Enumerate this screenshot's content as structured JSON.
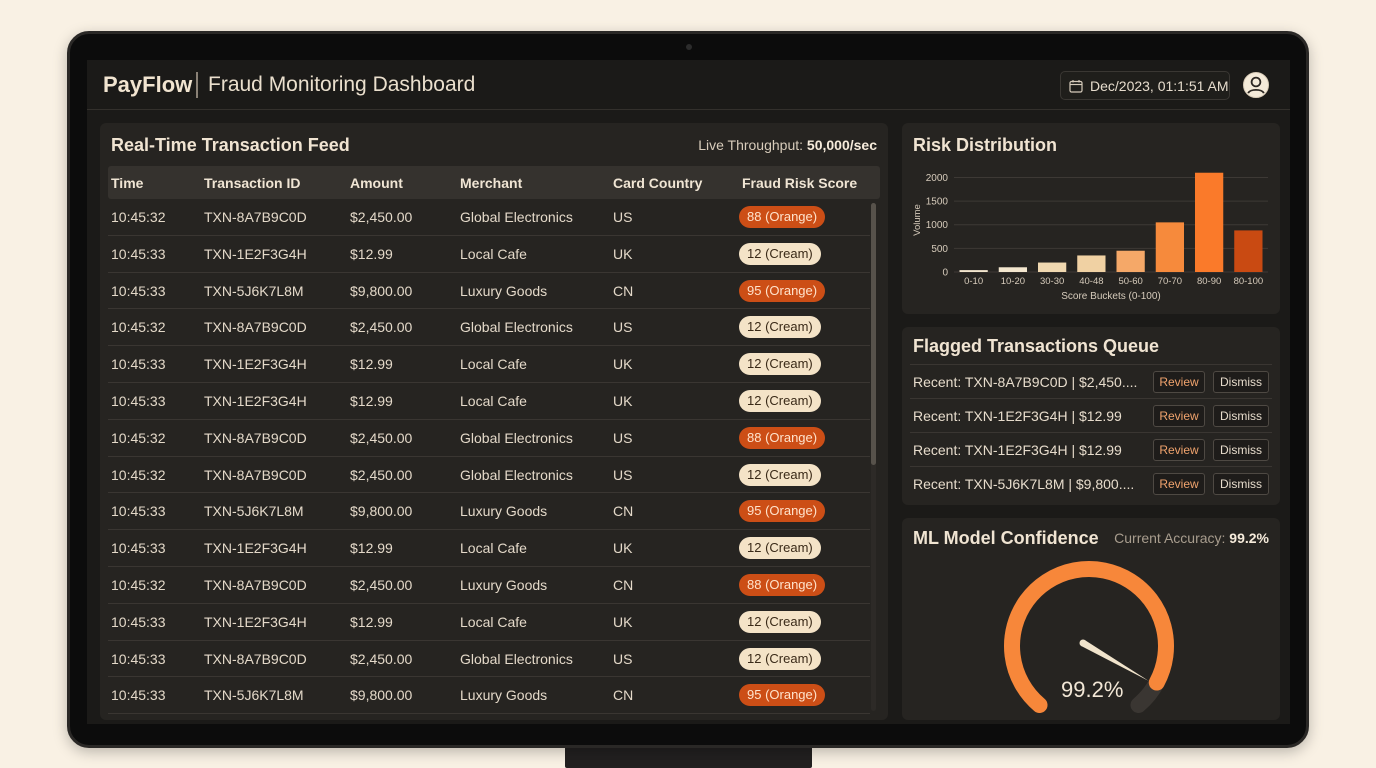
{
  "header": {
    "brand": "PayFlow",
    "title": "Fraud Monitoring Dashboard",
    "datetime": "Dec/2023, 01:1:51 AM"
  },
  "feed": {
    "title": "Real-Time Transaction Feed",
    "throughput_label": "Live Throughput:",
    "throughput_value": "50,000/sec",
    "columns": [
      "Time",
      "Transaction ID",
      "Amount",
      "Merchant",
      "Card Country",
      "Fraud Risk Score"
    ],
    "rows": [
      {
        "time": "10:45:32",
        "id": "TXN-8A7B9C0D",
        "amount": "$2,450.00",
        "merchant": "Global Electronics",
        "country": "US",
        "score": "88 (Orange)",
        "level": "orange"
      },
      {
        "time": "10:45:33",
        "id": "TXN-1E2F3G4H",
        "amount": "$12.99",
        "merchant": "Local Cafe",
        "country": "UK",
        "score": "12 (Cream)",
        "level": "cream"
      },
      {
        "time": "10:45:33",
        "id": "TXN-5J6K7L8M",
        "amount": "$9,800.00",
        "merchant": "Luxury Goods",
        "country": "CN",
        "score": "95 (Orange)",
        "level": "orange"
      },
      {
        "time": "10:45:32",
        "id": "TXN-8A7B9C0D",
        "amount": "$2,450.00",
        "merchant": "Global Electronics",
        "country": "US",
        "score": "12 (Cream)",
        "level": "cream"
      },
      {
        "time": "10:45:33",
        "id": "TXN-1E2F3G4H",
        "amount": "$12.99",
        "merchant": "Local Cafe",
        "country": "UK",
        "score": "12 (Cream)",
        "level": "cream"
      },
      {
        "time": "10:45:33",
        "id": "TXN-1E2F3G4H",
        "amount": "$12.99",
        "merchant": "Local Cafe",
        "country": "UK",
        "score": "12 (Cream)",
        "level": "cream"
      },
      {
        "time": "10:45:32",
        "id": "TXN-8A7B9C0D",
        "amount": "$2,450.00",
        "merchant": "Global Electronics",
        "country": "US",
        "score": "88 (Orange)",
        "level": "orange"
      },
      {
        "time": "10:45:32",
        "id": "TXN-8A7B9C0D",
        "amount": "$2,450.00",
        "merchant": "Global Electronics",
        "country": "US",
        "score": "12 (Cream)",
        "level": "cream"
      },
      {
        "time": "10:45:33",
        "id": "TXN-5J6K7L8M",
        "amount": "$9,800.00",
        "merchant": "Luxury Goods",
        "country": "CN",
        "score": "95 (Orange)",
        "level": "orange"
      },
      {
        "time": "10:45:33",
        "id": "TXN-1E2F3G4H",
        "amount": "$12.99",
        "merchant": "Local Cafe",
        "country": "UK",
        "score": "12 (Cream)",
        "level": "cream"
      },
      {
        "time": "10:45:32",
        "id": "TXN-8A7B9C0D",
        "amount": "$2,450.00",
        "merchant": "Luxury Goods",
        "country": "CN",
        "score": "88 (Orange)",
        "level": "orange"
      },
      {
        "time": "10:45:33",
        "id": "TXN-1E2F3G4H",
        "amount": "$12.99",
        "merchant": "Local Cafe",
        "country": "UK",
        "score": "12 (Cream)",
        "level": "cream"
      },
      {
        "time": "10:45:33",
        "id": "TXN-8A7B9C0D",
        "amount": "$2,450.00",
        "merchant": "Global Electronics",
        "country": "US",
        "score": "12 (Cream)",
        "level": "cream"
      },
      {
        "time": "10:45:33",
        "id": "TXN-5J6K7L8M",
        "amount": "$9,800.00",
        "merchant": "Luxury Goods",
        "country": "CN",
        "score": "95 (Orange)",
        "level": "orange"
      }
    ]
  },
  "risk": {
    "title": "Risk Distribution",
    "chart_data": {
      "type": "bar",
      "title": "Risk Distribution",
      "categories": [
        "0-10",
        "10-20",
        "30-30",
        "40-48",
        "50-60",
        "70-70",
        "80-90",
        "80-100"
      ],
      "values": [
        40,
        100,
        200,
        350,
        450,
        1050,
        2100,
        880
      ],
      "colors": [
        "#f3e6ce",
        "#f3e6ce",
        "#f0d8b0",
        "#f0d1a3",
        "#f5a868",
        "#f68a3c",
        "#fa7a2a",
        "#c94a12"
      ],
      "xlabel": "Score Buckets (0-100)",
      "ylabel": "Volume",
      "yticks": [
        0,
        500,
        1000,
        1500,
        2000
      ],
      "ylim": [
        0,
        2200
      ],
      "grid": true
    }
  },
  "queue": {
    "title": "Flagged Transactions Queue",
    "review_label": "Review",
    "dismiss_label": "Dismiss",
    "items": [
      "Recent: TXN-8A7B9C0D | $2,450....",
      "Recent: TXN-1E2F3G4H | $12.99",
      "Recent: TXN-1E2F3G4H | $12.99",
      "Recent: TXN-5J6K7L8M | $9,800...."
    ]
  },
  "model": {
    "title": "ML Model Confidence",
    "accuracy_label": "Current Accuracy:",
    "accuracy_value": "99.2%",
    "gauge_display": "99.2%",
    "gauge_fraction": 0.992,
    "accent": "#f7873a"
  }
}
